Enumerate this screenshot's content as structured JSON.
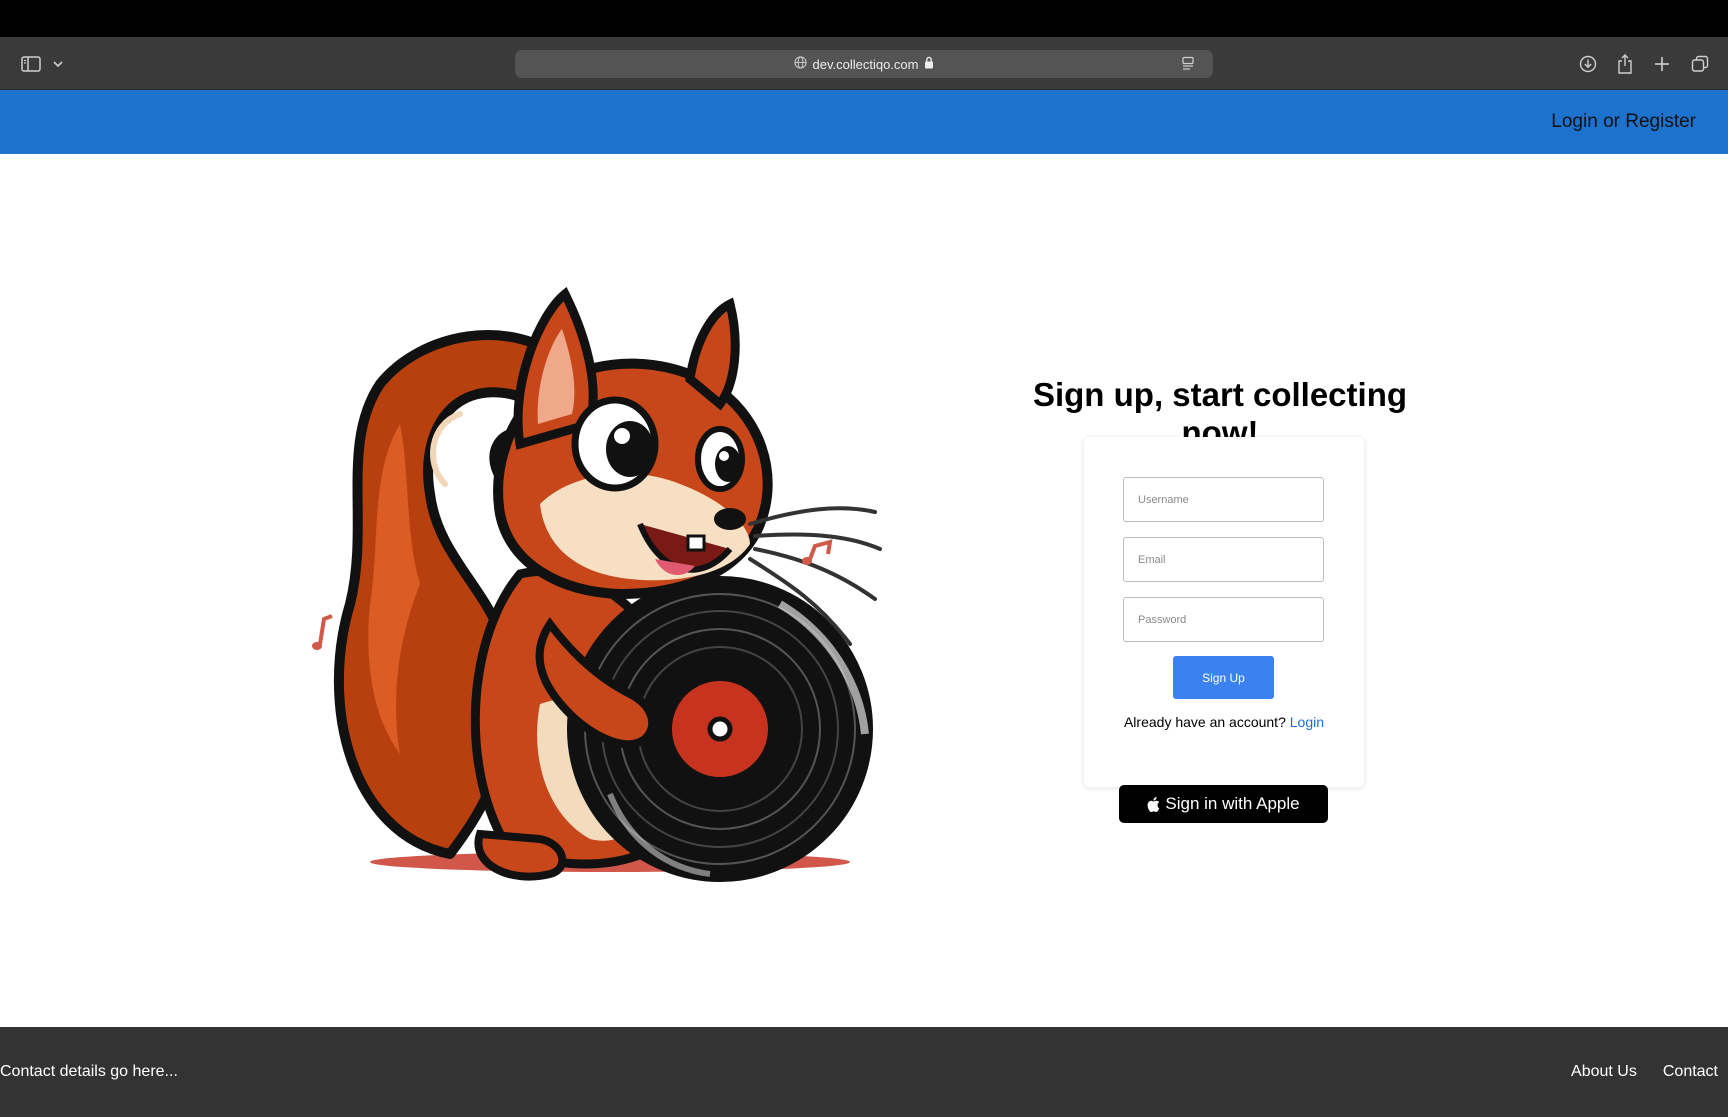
{
  "browser": {
    "url": "dev.collectiqo.com",
    "icons": [
      "sidebar-icon",
      "chevron-down-icon",
      "globe-icon",
      "lock-icon",
      "reader-icon",
      "download-icon",
      "share-icon",
      "plus-icon",
      "tabs-icon"
    ]
  },
  "navbar": {
    "login_link": "Login or Register",
    "color": "#1c72cd"
  },
  "main": {
    "headline": "Sign up, start collecting now!",
    "mascot": "squirrel-holding-vinyl-record-illustration"
  },
  "signup_form": {
    "username_placeholder": "Username",
    "email_placeholder": "Email",
    "password_placeholder": "Password",
    "submit_label": "Sign Up",
    "already_text": "Already have an account?",
    "login_link": "Login"
  },
  "apple_signin": {
    "label": "Sign in with Apple"
  },
  "footer": {
    "contact_text": "Contact details go here...",
    "links": [
      "About Us",
      "Contact"
    ]
  }
}
